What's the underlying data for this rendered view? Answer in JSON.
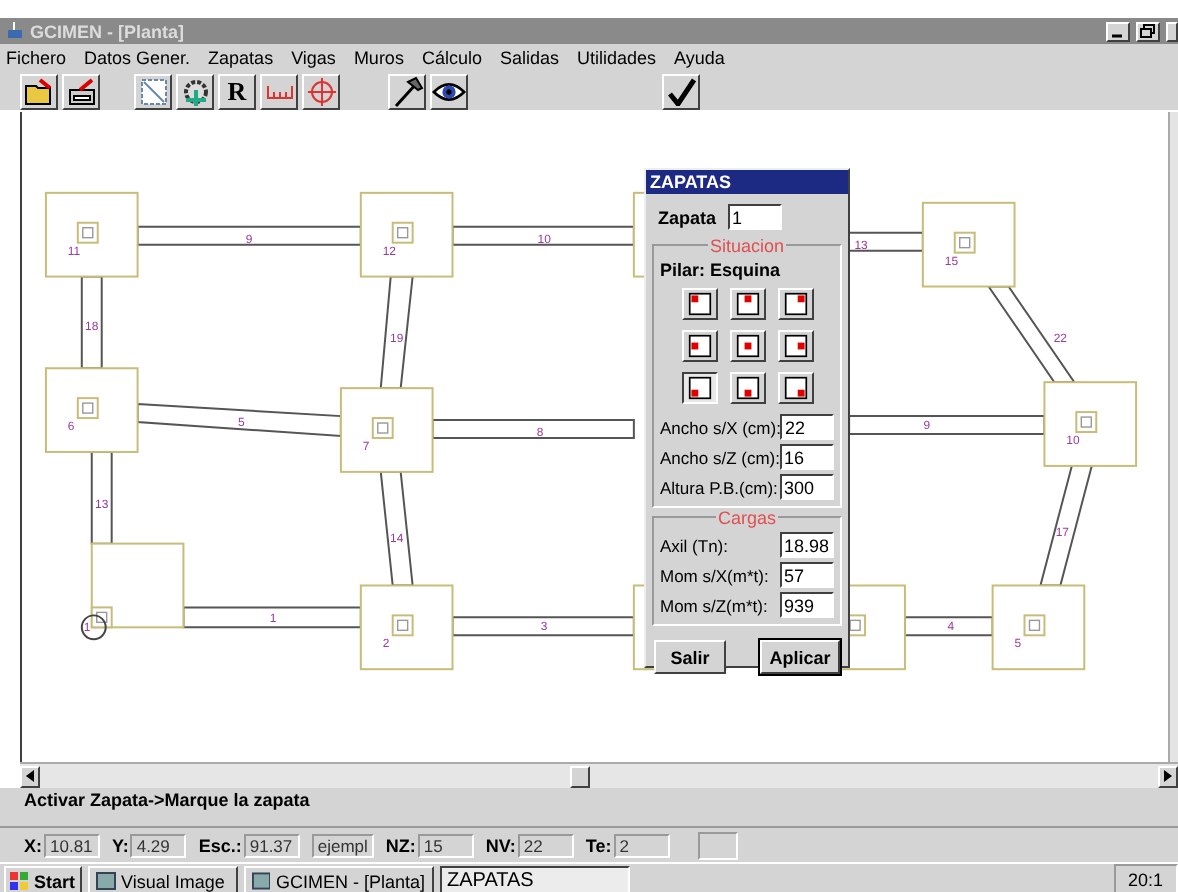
{
  "window": {
    "title": "GCIMEN - [Planta]"
  },
  "menu": [
    "Fichero",
    "Datos Gener.",
    "Zapatas",
    "Vigas",
    "Muros",
    "Cálculo",
    "Salidas",
    "Utilidades",
    "Ayuda"
  ],
  "toolbar_groups": [
    {
      "buttons": [
        {
          "kind": "folder"
        },
        {
          "kind": "print"
        }
      ]
    },
    {
      "buttons": [
        {
          "kind": "select"
        },
        {
          "kind": "gear"
        },
        {
          "kind": "text",
          "label": "R"
        },
        {
          "kind": "ruler"
        },
        {
          "kind": "target"
        }
      ]
    },
    {
      "buttons": [
        {
          "kind": "hammer"
        },
        {
          "kind": "eye"
        }
      ]
    },
    {
      "buttons": [
        {
          "kind": "check"
        }
      ]
    }
  ],
  "plan": {
    "footings": [
      {
        "label": "11",
        "selected": false
      },
      {
        "label": "12",
        "selected": false
      },
      {
        "selected": false
      },
      {
        "label": "15",
        "selected": false
      },
      {
        "label": "6",
        "selected": false
      },
      {
        "label": "7",
        "selected": false
      },
      {
        "label": "10",
        "selected": false
      },
      {
        "label": "2",
        "selected": false
      },
      {
        "label": "1",
        "selected": true
      },
      {
        "label": "5",
        "selected": false
      },
      {
        "selected": false
      },
      {
        "selected": false
      }
    ],
    "beams": [
      {
        "label": "9"
      },
      {
        "label": "10"
      },
      {
        "label": "13"
      },
      {
        "label": "18"
      },
      {
        "label": "19"
      },
      {
        "label": "5"
      },
      {
        "label": "8"
      },
      {
        "label": "9"
      },
      {
        "label": "22"
      },
      {
        "label": "17"
      },
      {
        "label": "13"
      },
      {
        "label": "14"
      },
      {
        "label": "1"
      },
      {
        "label": "3"
      },
      {
        "label": "4"
      }
    ]
  },
  "dialog": {
    "title": "ZAPATAS",
    "zapata_label": "Zapata",
    "zapata_value": "1",
    "situacion": {
      "legend": "Situacion",
      "pillar_label": "Pilar: Esquina",
      "positions": [
        {
          "selected": false
        },
        {
          "selected": false
        },
        {
          "selected": false
        },
        {
          "selected": false
        },
        {
          "selected": false
        },
        {
          "selected": false
        },
        {
          "selected": true
        },
        {
          "selected": false
        },
        {
          "selected": false
        }
      ],
      "fields": [
        {
          "label": "Ancho s/X (cm):",
          "value": "22"
        },
        {
          "label": "Ancho s/Z (cm):",
          "value": "16"
        },
        {
          "label": "Altura P.B.(cm):",
          "value": "300"
        }
      ]
    },
    "cargas": {
      "legend": "Cargas",
      "fields": [
        {
          "label": "Axil (Tn):",
          "value": "18.98"
        },
        {
          "label": "Mom s/X(m*t):",
          "value": "57"
        },
        {
          "label": "Mom s/Z(m*t):",
          "value": "939"
        }
      ]
    },
    "buttons": [
      {
        "label": "Salir",
        "default": false
      },
      {
        "label": "Aplicar",
        "default": true
      }
    ]
  },
  "message": "Activar Zapata->Marque la zapata",
  "status": [
    {
      "label": "X:",
      "value": "10.81"
    },
    {
      "label": "Y:",
      "value": "4.29"
    },
    {
      "label": "Esc.:",
      "value": "91.37"
    },
    {
      "value": "ejempl"
    },
    {
      "label": "NZ:",
      "value": "15"
    },
    {
      "label": "NV:",
      "value": "22"
    },
    {
      "label": "Te:",
      "value": "2"
    }
  ],
  "taskbar": {
    "start": "Start",
    "items": [
      {
        "label": "Visual Image",
        "selected": false
      },
      {
        "label": "GCIMEN - [Planta]",
        "selected": false
      },
      {
        "label": "ZAPATAS",
        "selected": true
      }
    ],
    "clock": "20:1"
  }
}
